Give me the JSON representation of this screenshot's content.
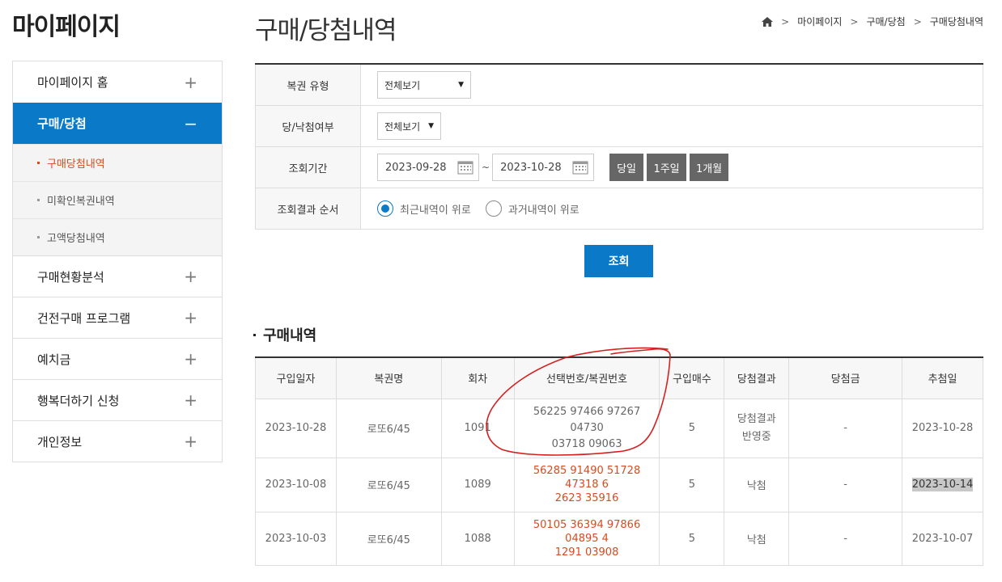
{
  "sidebar": {
    "title": "마이페이지",
    "items": [
      {
        "label": "마이페이지 홈",
        "sign": "+"
      },
      {
        "label": "구매/당첨",
        "sign": "−"
      },
      {
        "label": "구매현황분석",
        "sign": "+"
      },
      {
        "label": "건전구매 프로그램",
        "sign": "+"
      },
      {
        "label": "예치금",
        "sign": "+"
      },
      {
        "label": "행복더하기 신청",
        "sign": "+"
      },
      {
        "label": "개인정보",
        "sign": "+"
      }
    ],
    "subitems": [
      "구매당첨내역",
      "미확인복권내역",
      "고액당첨내역"
    ]
  },
  "header": {
    "title": "구매/당첨내역",
    "breadcrumb": [
      "마이페이지",
      "구매/당첨",
      "구매당첨내역"
    ]
  },
  "search": {
    "lottery_type_label": "복권 유형",
    "lottery_type_value": "전체보기",
    "win_status_label": "당/낙첨여부",
    "win_status_value": "전체보기",
    "period_label": "조회기간",
    "start_date": "2023-09-28",
    "end_date": "2023-10-28",
    "tilde": "~",
    "period_buttons": [
      "당일",
      "1주일",
      "1개월"
    ],
    "order_label": "조회결과 순서",
    "order_options": [
      "최근내역이 위로",
      "과거내역이 위로"
    ],
    "submit": "조회"
  },
  "results": {
    "title": "구매내역",
    "columns": [
      "구입일자",
      "복권명",
      "회차",
      "선택번호/복권번호",
      "구입매수",
      "당첨결과",
      "당첨금",
      "추첨일"
    ],
    "rows": [
      {
        "date": "2023-10-28",
        "name": "로또6/45",
        "round": "1091",
        "numbers_1": "56225 97466 97267 04730",
        "numbers_2": "03718 09063",
        "qty": "5",
        "result_1": "당첨결과",
        "result_2": "반영중",
        "prize": "-",
        "draw": "2023-10-28"
      },
      {
        "date": "2023-10-08",
        "name": "로또6/45",
        "round": "1089",
        "numbers_1": "56285 91490 51728 47318 6",
        "numbers_2": "2623 35916",
        "qty": "5",
        "result_1": "낙첨",
        "result_2": "",
        "prize": "-",
        "draw": "2023-10-14"
      },
      {
        "date": "2023-10-03",
        "name": "로또6/45",
        "round": "1088",
        "numbers_1": "50105 36394 97866 04895 4",
        "numbers_2": "1291 03908",
        "qty": "5",
        "result_1": "낙첨",
        "result_2": "",
        "prize": "-",
        "draw": "2023-10-07"
      }
    ]
  },
  "colors": {
    "accent": "#0a7ac8",
    "highlight_red": "#d84b1f",
    "annotation": "#d42020"
  }
}
